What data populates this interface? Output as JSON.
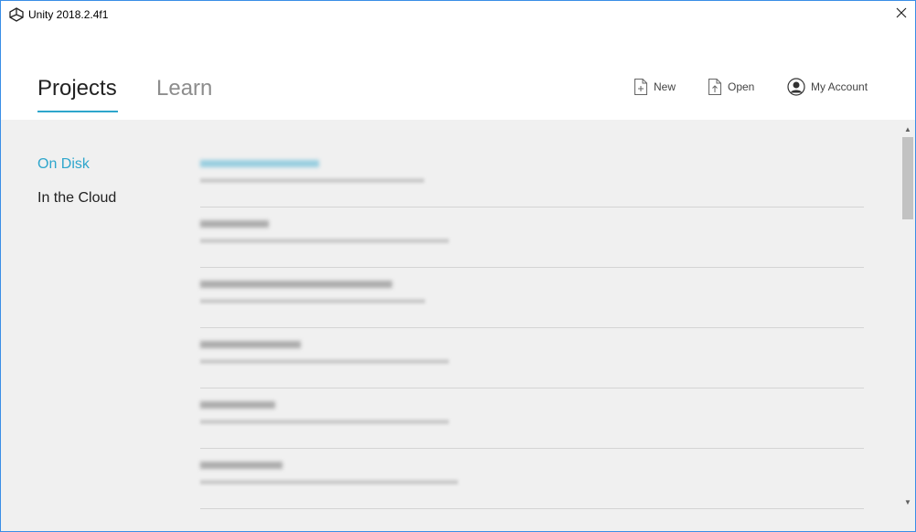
{
  "window": {
    "title": "Unity 2018.2.4f1"
  },
  "header": {
    "tabs": [
      {
        "label": "Projects",
        "active": true
      },
      {
        "label": "Learn",
        "active": false
      }
    ],
    "actions": {
      "new_label": "New",
      "open_label": "Open",
      "account_label": "My Account"
    }
  },
  "sidebar": {
    "items": [
      {
        "label": "On Disk",
        "selected": true
      },
      {
        "label": "In the Cloud",
        "selected": false
      }
    ]
  },
  "projects": [
    {
      "name": "",
      "path": ""
    },
    {
      "name": "",
      "path": ""
    },
    {
      "name": "",
      "path": ""
    },
    {
      "name": "",
      "path": ""
    },
    {
      "name": "",
      "path": ""
    },
    {
      "name": "",
      "path": ""
    }
  ],
  "colors": {
    "accent": "#2ea6cc",
    "content_bg": "#f0f0f0",
    "window_border": "#3a8ee6"
  }
}
